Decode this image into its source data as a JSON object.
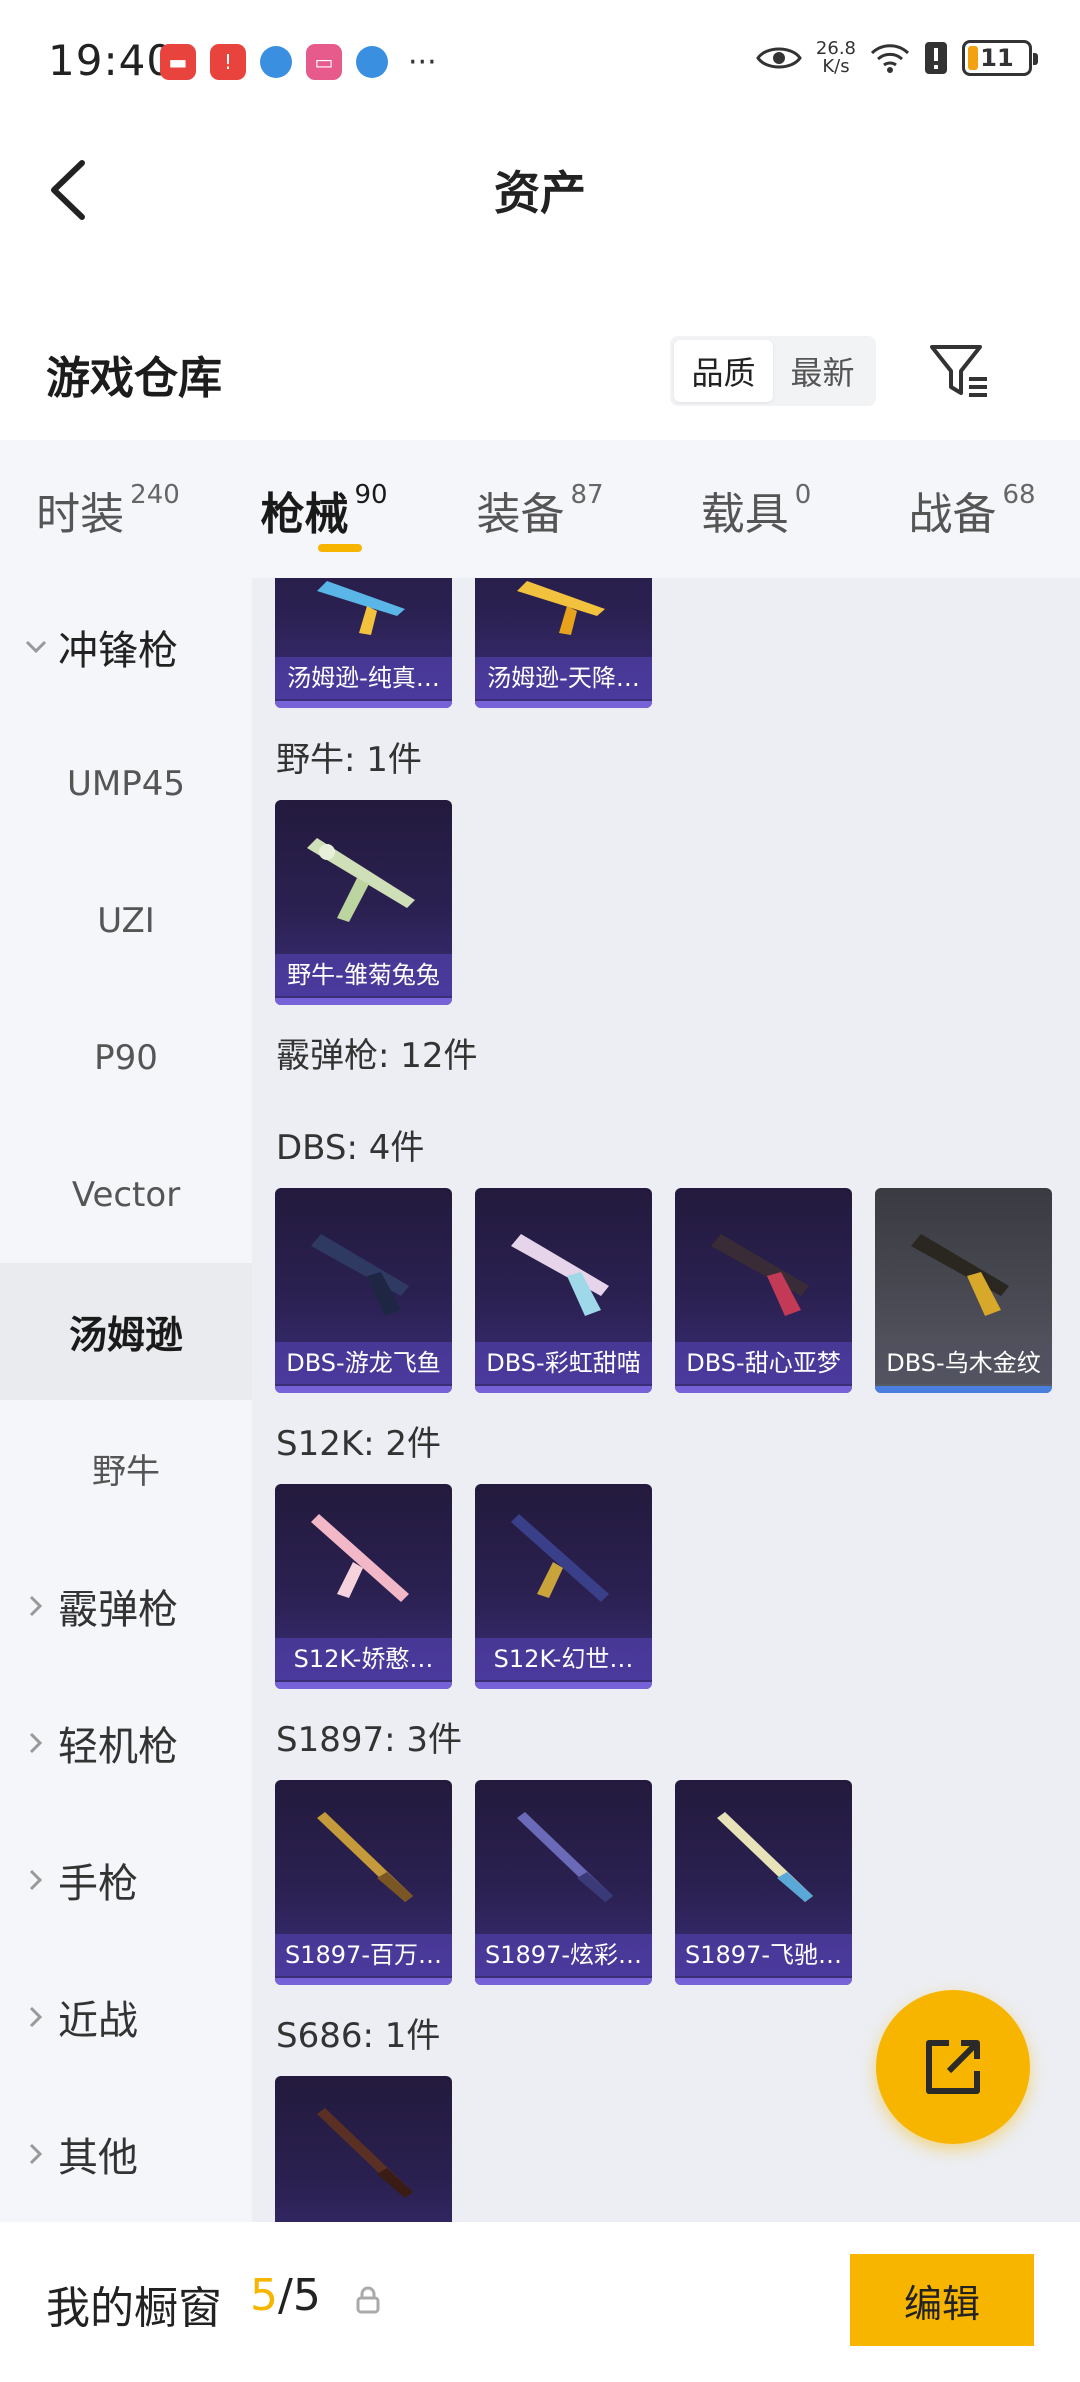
{
  "status_bar": {
    "time": "19:40",
    "more": "···",
    "speed_value": "26.8",
    "speed_unit": "K/s",
    "battery": "11"
  },
  "header": {
    "title": "资产"
  },
  "warehouse": {
    "title": "游戏仓库",
    "sort": [
      "品质",
      "最新"
    ],
    "active_sort": "品质"
  },
  "tabs": [
    {
      "label": "时装",
      "count": "240"
    },
    {
      "label": "枪械",
      "count": "90"
    },
    {
      "label": "装备",
      "count": "87"
    },
    {
      "label": "载具",
      "count": "0"
    },
    {
      "label": "战备",
      "count": "68"
    }
  ],
  "active_tab": "枪械",
  "sidebar": {
    "items": [
      {
        "label": "冲锋枪",
        "type": "group",
        "expanded": true
      },
      {
        "label": "UMP45",
        "type": "sub"
      },
      {
        "label": "UZI",
        "type": "sub"
      },
      {
        "label": "P90",
        "type": "sub"
      },
      {
        "label": "Vector",
        "type": "sub"
      },
      {
        "label": "汤姆逊",
        "type": "sub",
        "selected": true
      },
      {
        "label": "野牛",
        "type": "sub"
      },
      {
        "label": "霰弹枪",
        "type": "group"
      },
      {
        "label": "轻机枪",
        "type": "group"
      },
      {
        "label": "手枪",
        "type": "group"
      },
      {
        "label": "近战",
        "type": "group"
      },
      {
        "label": "其他",
        "type": "group"
      }
    ]
  },
  "content": {
    "top_cards": [
      "汤姆逊-纯真…",
      "汤姆逊-天降…"
    ],
    "sections": [
      {
        "title": "野牛: 1件",
        "cards": [
          "野牛-雏菊兔兔"
        ]
      },
      {
        "title": "霰弹枪: 12件",
        "cards": []
      },
      {
        "title": "DBS: 4件",
        "cards": [
          "DBS-游龙飞鱼",
          "DBS-彩虹甜喵",
          "DBS-甜心亚梦",
          "DBS-乌木金纹"
        ]
      },
      {
        "title": "S12K: 2件",
        "cards": [
          "S12K-娇憨…",
          "S12K-幻世…"
        ]
      },
      {
        "title": "S1897: 3件",
        "cards": [
          "S1897-百万…",
          "S1897-炫彩…",
          "S1897-飞驰…"
        ]
      },
      {
        "title": "S686: 1件",
        "cards": [
          ""
        ]
      }
    ]
  },
  "bottom_bar": {
    "label": "我的橱窗",
    "current": "5",
    "separator": "/",
    "total": "5",
    "edit_label": "编辑"
  },
  "colors": {
    "accent": "#f7b500",
    "card_purple": "#2b2152",
    "card_gray": "#4a4b54",
    "sidebar_bg": "#f4f6f9",
    "content_bg": "#eceef3"
  }
}
